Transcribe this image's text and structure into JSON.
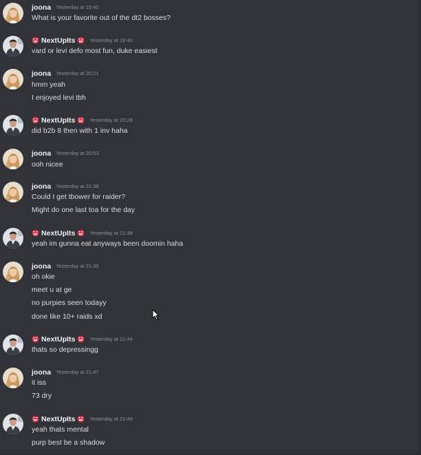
{
  "users": {
    "joona": "joona",
    "nextupits": "NextUpIts"
  },
  "messages": [
    {
      "author": "joona",
      "time": "Yesterday at 19:40",
      "lines": [
        "What is your favorite out of the dt2 bosses?"
      ]
    },
    {
      "author": "NextUpIts",
      "time": "Yesterday at 19:40",
      "lines": [
        "vard or levi defo most fun, duke easiest"
      ]
    },
    {
      "author": "joona",
      "time": "Yesterday at 20:21",
      "lines": [
        "hmm yeah",
        "I enjoyed levi tbh"
      ]
    },
    {
      "author": "NextUpIts",
      "time": "Yesterday at 20:28",
      "lines": [
        "did b2b 8 then with 1 inv haha"
      ]
    },
    {
      "author": "joona",
      "time": "Yesterday at 20:53",
      "lines": [
        "ooh nicee"
      ]
    },
    {
      "author": "joona",
      "time": "Yesterday at 21:38",
      "lines": [
        "Could I get tbower for raider?",
        "Might do one last toa for the day"
      ]
    },
    {
      "author": "NextUpIts",
      "time": "Yesterday at 21:38",
      "lines": [
        "yeah im gunna eat anyways been doomin haha"
      ]
    },
    {
      "author": "joona",
      "time": "Yesterday at 21:39",
      "lines": [
        "oh okie",
        "meet u at ge",
        "no purpies  seen todayy",
        "done like 10+ raids xd"
      ]
    },
    {
      "author": "NextUpIts",
      "time": "Yesterday at 21:44",
      "lines": [
        "thats so depressingg"
      ]
    },
    {
      "author": "joona",
      "time": "Yesterday at 21:47",
      "lines": [
        "it iss",
        "73 dry"
      ]
    },
    {
      "author": "NextUpIts",
      "time": "Yesterday at 21:49",
      "lines": [
        "yeah thats mental",
        "purp best be a shadow"
      ]
    }
  ],
  "colors": {
    "background": "#313338",
    "username": "#f2f3f5",
    "timestamp": "#8e9297",
    "message_text": "#dbdee1",
    "emoji_red": "#dd2e44"
  },
  "icons": {
    "name_decoration": "angry-face-emoji",
    "pointer": "cursor-arrow-icon"
  }
}
